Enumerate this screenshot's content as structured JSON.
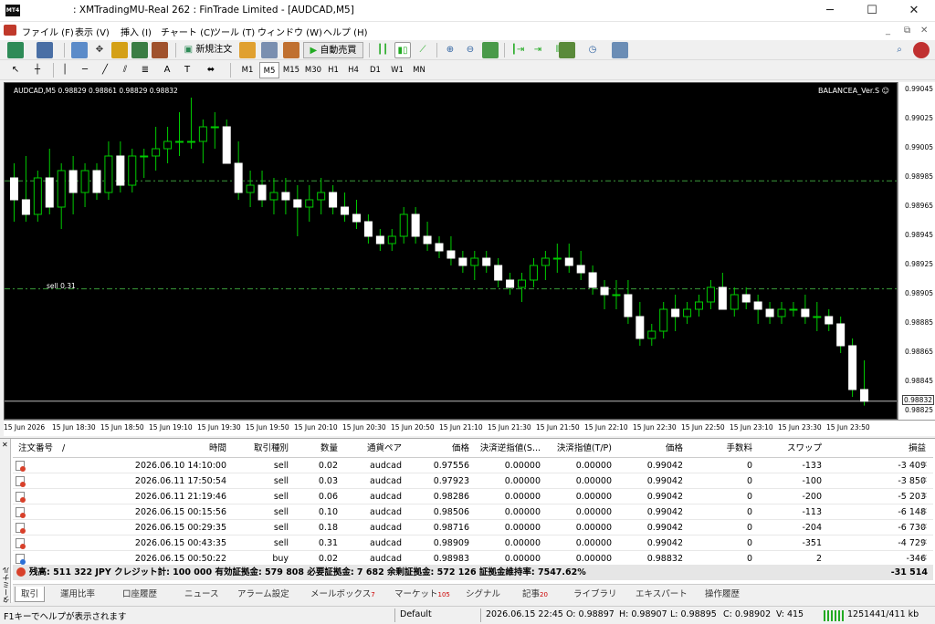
{
  "window": {
    "title": ": XMTradingMU-Real 262 : FinTrade Limited - [AUDCAD,M5]",
    "minimize": "─",
    "maximize": "☐",
    "close": "✕"
  },
  "menu": [
    "ファイル (F)",
    "表示 (V)",
    "挿入 (I)",
    "チャート (C)",
    "ツール (T)",
    "ウィンドウ (W)",
    "ヘルプ (H)"
  ],
  "toolbar": {
    "new_order": "新規注文",
    "auto_trade": "自動売買"
  },
  "timeframes": [
    "M1",
    "M5",
    "M15",
    "M30",
    "H1",
    "H4",
    "D1",
    "W1",
    "MN"
  ],
  "active_timeframe": "M5",
  "chart": {
    "ohlc_label": "AUDCAD,M5  0.98829 0.98861 0.98829 0.98832",
    "ea_label": "BALANCEA_Ver.S ☺",
    "sell_label": "sell 0.31",
    "bid_label": "0.98832",
    "price_ticks": [
      "0.99045",
      "0.99025",
      "0.99005",
      "0.98985",
      "0.98965",
      "0.98945",
      "0.98925",
      "0.98905",
      "0.98885",
      "0.98865",
      "0.98845",
      "0.98825"
    ],
    "time_ticks": [
      "15 Jun 2026",
      "15 Jun 18:30",
      "15 Jun 18:50",
      "15 Jun 19:10",
      "15 Jun 19:30",
      "15 Jun 19:50",
      "15 Jun 20:10",
      "15 Jun 20:30",
      "15 Jun 20:50",
      "15 Jun 21:10",
      "15 Jun 21:30",
      "15 Jun 21:50",
      "15 Jun 22:10",
      "15 Jun 22:30",
      "15 Jun 22:50",
      "15 Jun 23:10",
      "15 Jun 23:30",
      "15 Jun 23:50"
    ]
  },
  "chart_data": {
    "type": "candlestick",
    "symbol": "AUDCAD",
    "timeframe": "M5",
    "ylim": [
      0.9882,
      0.9905
    ],
    "levels": {
      "sell_line": 0.98909,
      "dash_line_top": 0.98983,
      "bid_line": 0.98832
    },
    "candles": [
      [
        0.98985,
        0.98995,
        0.98955,
        0.9897
      ],
      [
        0.9897,
        0.99,
        0.98955,
        0.9896
      ],
      [
        0.9896,
        0.9899,
        0.98955,
        0.98985
      ],
      [
        0.98985,
        0.99005,
        0.9896,
        0.98965
      ],
      [
        0.98965,
        0.98995,
        0.9895,
        0.9899
      ],
      [
        0.9899,
        0.99,
        0.9896,
        0.98975
      ],
      [
        0.98975,
        0.98995,
        0.98965,
        0.9899
      ],
      [
        0.9899,
        0.98995,
        0.9897,
        0.98975
      ],
      [
        0.98975,
        0.9901,
        0.9897,
        0.99
      ],
      [
        0.99,
        0.9901,
        0.98975,
        0.9898
      ],
      [
        0.9898,
        0.99005,
        0.98975,
        0.99
      ],
      [
        0.99,
        0.99005,
        0.98985,
        0.99
      ],
      [
        0.99,
        0.9902,
        0.9899,
        0.99005
      ],
      [
        0.99005,
        0.9902,
        0.98995,
        0.9901
      ],
      [
        0.9901,
        0.9903,
        0.99,
        0.9901
      ],
      [
        0.9901,
        0.9904,
        0.99005,
        0.9901
      ],
      [
        0.9901,
        0.99025,
        0.98995,
        0.9902
      ],
      [
        0.9902,
        0.9903,
        0.99005,
        0.9902
      ],
      [
        0.9902,
        0.99025,
        0.98995,
        0.98995
      ],
      [
        0.98995,
        0.9901,
        0.9897,
        0.98975
      ],
      [
        0.98975,
        0.9899,
        0.98965,
        0.9898
      ],
      [
        0.9898,
        0.9899,
        0.98965,
        0.9897
      ],
      [
        0.9897,
        0.98985,
        0.9896,
        0.98975
      ],
      [
        0.98975,
        0.98985,
        0.9896,
        0.9897
      ],
      [
        0.9897,
        0.9898,
        0.98945,
        0.98965
      ],
      [
        0.98965,
        0.9898,
        0.98955,
        0.9897
      ],
      [
        0.9897,
        0.98985,
        0.9896,
        0.98975
      ],
      [
        0.98975,
        0.9898,
        0.9896,
        0.98965
      ],
      [
        0.98965,
        0.98975,
        0.98955,
        0.9896
      ],
      [
        0.9896,
        0.9897,
        0.9895,
        0.98955
      ],
      [
        0.98955,
        0.9896,
        0.9894,
        0.98945
      ],
      [
        0.98945,
        0.9895,
        0.98935,
        0.9894
      ],
      [
        0.9894,
        0.9895,
        0.98935,
        0.98945
      ],
      [
        0.98945,
        0.98965,
        0.9894,
        0.9896
      ],
      [
        0.9896,
        0.98965,
        0.9894,
        0.98945
      ],
      [
        0.98945,
        0.98955,
        0.98935,
        0.9894
      ],
      [
        0.9894,
        0.98945,
        0.9893,
        0.98935
      ],
      [
        0.98935,
        0.98945,
        0.98925,
        0.9893
      ],
      [
        0.9893,
        0.98935,
        0.9892,
        0.98925
      ],
      [
        0.98925,
        0.98935,
        0.98915,
        0.9893
      ],
      [
        0.9893,
        0.98935,
        0.9892,
        0.98925
      ],
      [
        0.98925,
        0.9893,
        0.9891,
        0.98915
      ],
      [
        0.98915,
        0.9892,
        0.98905,
        0.9891
      ],
      [
        0.9891,
        0.9892,
        0.989,
        0.98915
      ],
      [
        0.98915,
        0.9893,
        0.9891,
        0.98925
      ],
      [
        0.98925,
        0.98935,
        0.98915,
        0.9893
      ],
      [
        0.9893,
        0.9894,
        0.9892,
        0.9893
      ],
      [
        0.9893,
        0.9894,
        0.9892,
        0.98925
      ],
      [
        0.98925,
        0.98935,
        0.98915,
        0.9892
      ],
      [
        0.9892,
        0.98925,
        0.98905,
        0.9891
      ],
      [
        0.9891,
        0.98915,
        0.98895,
        0.98905
      ],
      [
        0.98905,
        0.98915,
        0.98895,
        0.98905
      ],
      [
        0.98905,
        0.98915,
        0.98885,
        0.9889
      ],
      [
        0.9889,
        0.989,
        0.9887,
        0.98875
      ],
      [
        0.98875,
        0.98885,
        0.9887,
        0.9888
      ],
      [
        0.9888,
        0.989,
        0.98875,
        0.98895
      ],
      [
        0.98895,
        0.98905,
        0.9888,
        0.9889
      ],
      [
        0.9889,
        0.989,
        0.98885,
        0.98895
      ],
      [
        0.98895,
        0.98905,
        0.9889,
        0.989
      ],
      [
        0.989,
        0.98915,
        0.98895,
        0.9891
      ],
      [
        0.9891,
        0.9892,
        0.98895,
        0.98895
      ],
      [
        0.98895,
        0.9891,
        0.9889,
        0.98905
      ],
      [
        0.98905,
        0.9891,
        0.98895,
        0.989
      ],
      [
        0.989,
        0.98905,
        0.98885,
        0.98895
      ],
      [
        0.98895,
        0.989,
        0.98885,
        0.9889
      ],
      [
        0.9889,
        0.989,
        0.98885,
        0.98895
      ],
      [
        0.98895,
        0.989,
        0.9889,
        0.98895
      ],
      [
        0.98895,
        0.98905,
        0.98885,
        0.9889
      ],
      [
        0.9889,
        0.989,
        0.9888,
        0.9889
      ],
      [
        0.9889,
        0.98895,
        0.9888,
        0.98885
      ],
      [
        0.98885,
        0.9889,
        0.98865,
        0.9887
      ],
      [
        0.9887,
        0.98875,
        0.98835,
        0.9884
      ],
      [
        0.9884,
        0.9886,
        0.98829,
        0.98832
      ]
    ]
  },
  "terminal": {
    "side_label": "ターミナル",
    "headers": [
      "注文番号",
      "/",
      "時間",
      "取引種別",
      "数量",
      "通貨ペア",
      "価格",
      "決済逆指値(S...",
      "決済指値(T/P)",
      "価格",
      "手数料",
      "スワップ",
      "損益"
    ],
    "rows": [
      {
        "type": "sell",
        "time": "2026.06.10 14:10:00",
        "side": "sell",
        "qty": "0.02",
        "pair": "audcad",
        "price": "0.97556",
        "sl": "0.00000",
        "tp": "0.00000",
        "cur": "0.99042",
        "fee": "0",
        "swap": "-133",
        "pl": "-3 409"
      },
      {
        "type": "sell",
        "time": "2026.06.11 17:50:54",
        "side": "sell",
        "qty": "0.03",
        "pair": "audcad",
        "price": "0.97923",
        "sl": "0.00000",
        "tp": "0.00000",
        "cur": "0.99042",
        "fee": "0",
        "swap": "-100",
        "pl": "-3 850"
      },
      {
        "type": "sell",
        "time": "2026.06.11 21:19:46",
        "side": "sell",
        "qty": "0.06",
        "pair": "audcad",
        "price": "0.98286",
        "sl": "0.00000",
        "tp": "0.00000",
        "cur": "0.99042",
        "fee": "0",
        "swap": "-200",
        "pl": "-5 203"
      },
      {
        "type": "sell",
        "time": "2026.06.15 00:15:56",
        "side": "sell",
        "qty": "0.10",
        "pair": "audcad",
        "price": "0.98506",
        "sl": "0.00000",
        "tp": "0.00000",
        "cur": "0.99042",
        "fee": "0",
        "swap": "-113",
        "pl": "-6 148"
      },
      {
        "type": "sell",
        "time": "2026.06.15 00:29:35",
        "side": "sell",
        "qty": "0.18",
        "pair": "audcad",
        "price": "0.98716",
        "sl": "0.00000",
        "tp": "0.00000",
        "cur": "0.99042",
        "fee": "0",
        "swap": "-204",
        "pl": "-6 730"
      },
      {
        "type": "sell",
        "time": "2026.06.15 00:43:35",
        "side": "sell",
        "qty": "0.31",
        "pair": "audcad",
        "price": "0.98909",
        "sl": "0.00000",
        "tp": "0.00000",
        "cur": "0.99042",
        "fee": "0",
        "swap": "-351",
        "pl": "-4 729"
      },
      {
        "type": "buy",
        "time": "2026.06.15 00:50:22",
        "side": "buy",
        "qty": "0.02",
        "pair": "audcad",
        "price": "0.98983",
        "sl": "0.00000",
        "tp": "0.00000",
        "cur": "0.98832",
        "fee": "0",
        "swap": "2",
        "pl": "-346"
      }
    ],
    "summary": "残高: 511 322 JPY  クレジット計: 100 000  有効証拠金: 579 808  必要証拠金: 7 682  余剰証拠金: 572 126  証拠金維持率: 7547.62%",
    "summary_total": "-31 514",
    "tabs": [
      {
        "label": "取引",
        "badge": ""
      },
      {
        "label": "運用比率",
        "badge": ""
      },
      {
        "label": "口座履歴",
        "badge": ""
      },
      {
        "label": "ニュース",
        "badge": ""
      },
      {
        "label": "アラーム設定",
        "badge": ""
      },
      {
        "label": "メールボックス",
        "badge": "7"
      },
      {
        "label": "マーケット",
        "badge": "105"
      },
      {
        "label": "シグナル",
        "badge": ""
      },
      {
        "label": "記事",
        "badge": "20"
      },
      {
        "label": "ライブラリ",
        "badge": ""
      },
      {
        "label": "エキスパート",
        "badge": ""
      },
      {
        "label": "操作履歴",
        "badge": ""
      }
    ]
  },
  "status": {
    "help": "F1キーでヘルプが表示されます",
    "profile": "Default",
    "datetime": "2026.06.15 22:45",
    "open": "O: 0.98897",
    "high": "H: 0.98907",
    "low": "L: 0.98895",
    "close": "C: 0.98902",
    "volume": "V: 415",
    "traffic": "1251441/411 kb"
  }
}
